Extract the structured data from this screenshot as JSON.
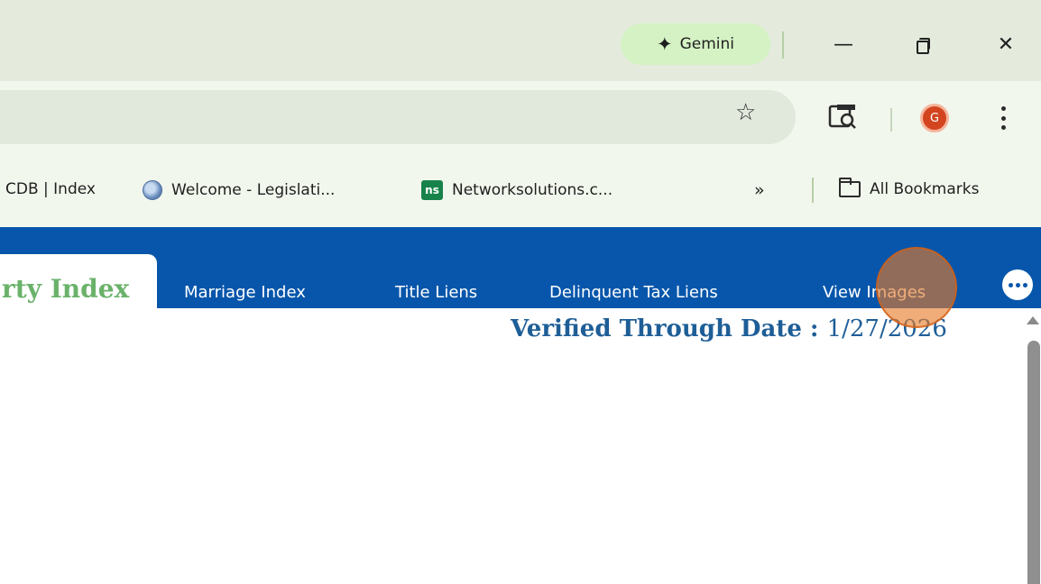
{
  "browser": {
    "gemini_label": "Gemini",
    "window_controls": {
      "minimize_icon": "minimize-icon",
      "restore_icon": "restore-icon",
      "close_icon": "close-icon"
    },
    "avatar_letter": "G",
    "bookmarks": [
      {
        "label": "CDB | Index",
        "icon": "none"
      },
      {
        "label": "Welcome - Legislati...",
        "icon": "globe-icon"
      },
      {
        "label": "Networksolutions.c...",
        "icon": "ns-icon",
        "icon_text": "ns"
      }
    ],
    "bookmarks_overflow": "»",
    "all_bookmarks_label": "All Bookmarks"
  },
  "page": {
    "nav": {
      "active_tab": "rty Index",
      "tabs": [
        "Marriage Index",
        "Title Liens",
        "Delinquent Tax Liens",
        "View Images"
      ]
    },
    "verified": {
      "label": "Verified Through Date :",
      "date": "1/27/2026"
    }
  },
  "colors": {
    "nav_blue": "#0756ab",
    "active_tab_text": "#6ab26a",
    "verified_text": "#1e5e97",
    "gemini_bg": "#d5f2c4",
    "avatar_bg": "#d2451f"
  }
}
